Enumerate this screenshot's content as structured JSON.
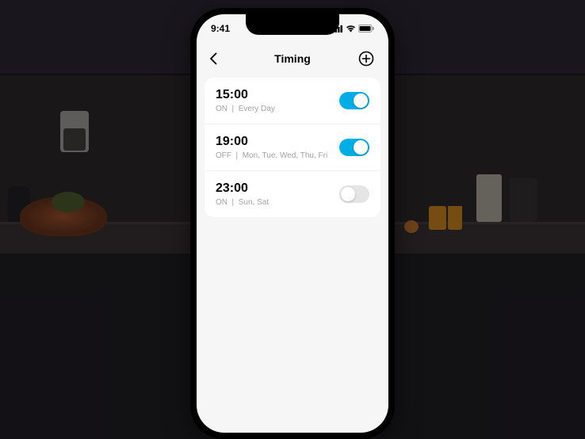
{
  "status": {
    "time": "9:41"
  },
  "header": {
    "title": "Timing"
  },
  "timers": [
    {
      "time": "15:00",
      "action": "ON",
      "days": "Every Day",
      "enabled": true
    },
    {
      "time": "19:00",
      "action": "OFF",
      "days": "Mon, Tue, Wed, Thu, Fri",
      "enabled": true
    },
    {
      "time": "23:00",
      "action": "ON",
      "days": "Sun, Sat",
      "enabled": false
    }
  ]
}
